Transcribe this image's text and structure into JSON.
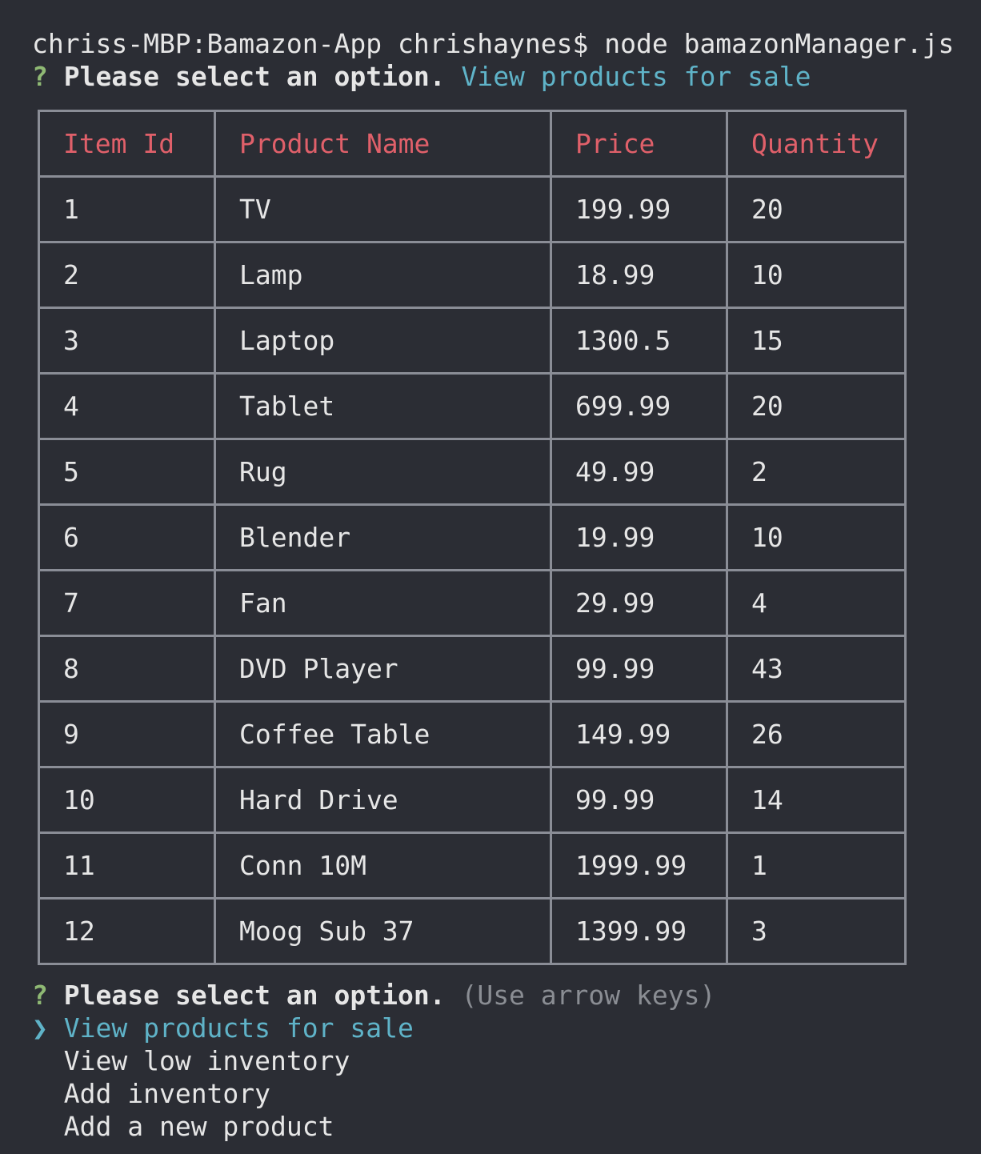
{
  "terminal": {
    "command_line": "chriss-MBP:Bamazon-App chrishaynes$ node bamazonManager.js",
    "first_prompt": {
      "mark": "?",
      "question": "Please select an option.",
      "answer": "View products for sale"
    },
    "table": {
      "headers": [
        "Item Id",
        "Product Name",
        "Price",
        "Quantity"
      ],
      "rows": [
        [
          "1",
          "TV",
          "199.99",
          "20"
        ],
        [
          "2",
          "Lamp",
          "18.99",
          "10"
        ],
        [
          "3",
          "Laptop",
          "1300.5",
          "15"
        ],
        [
          "4",
          "Tablet",
          "699.99",
          "20"
        ],
        [
          "5",
          "Rug",
          "49.99",
          "2"
        ],
        [
          "6",
          "Blender",
          "19.99",
          "10"
        ],
        [
          "7",
          "Fan",
          "29.99",
          "4"
        ],
        [
          "8",
          "DVD Player",
          "99.99",
          "43"
        ],
        [
          "9",
          "Coffee Table",
          "149.99",
          "26"
        ],
        [
          "10",
          "Hard Drive",
          "99.99",
          "14"
        ],
        [
          "11",
          "Conn 10M",
          "1999.99",
          "1"
        ],
        [
          "12",
          "Moog Sub 37",
          "1399.99",
          "3"
        ]
      ]
    },
    "second_prompt": {
      "mark": "?",
      "question": "Please select an option.",
      "hint": "(Use arrow keys)",
      "pointer": "❯",
      "options": [
        "View products for sale",
        "View low inventory",
        "Add inventory",
        "Add a new product"
      ],
      "selected_index": 0
    }
  },
  "colors": {
    "background": "#2b2d34",
    "prompt_mark": "#8fb974",
    "selection": "#5fb3c8",
    "table_header": "#e0606a",
    "table_border": "#8a8d96",
    "hint": "#8a8d93"
  }
}
